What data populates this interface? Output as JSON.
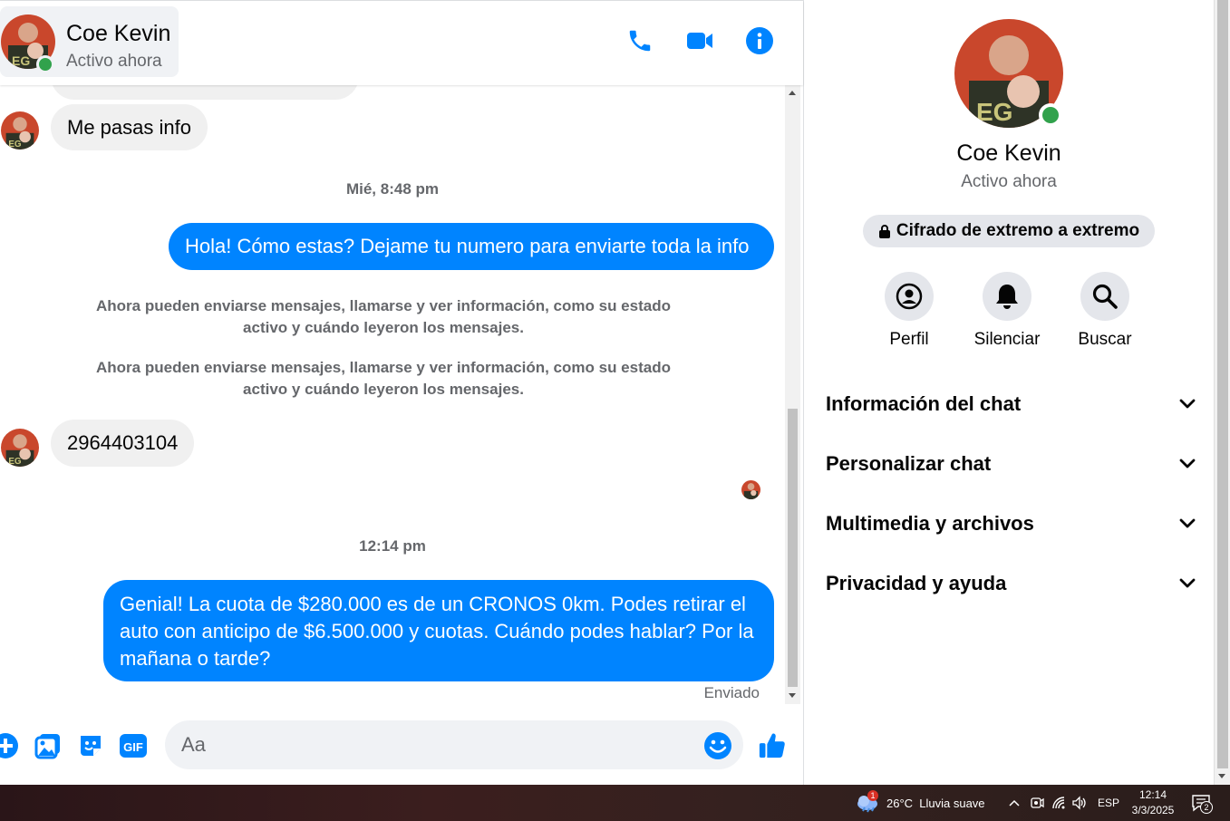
{
  "header": {
    "name": "Coe Kevin",
    "status": "Activo ahora"
  },
  "messages": {
    "incoming_1": "Me pasas info",
    "timestamp_1": "Mié, 8:48 pm",
    "outgoing_1": "Hola! Cómo estas? Dejame tu numero para enviarte toda la info",
    "system_1": "Ahora pueden enviarse mensajes, llamarse y ver información, como su estado activo y cuándo leyeron los mensajes.",
    "system_2": "Ahora pueden enviarse mensajes, llamarse y ver información, como su estado activo y cuándo leyeron los mensajes.",
    "incoming_2": "2964403104",
    "timestamp_2": "12:14 pm",
    "outgoing_2": "Genial! La cuota de $280.000 es de un CRONOS 0km. Podes retirar el auto con anticipo de $6.500.000 y cuotas. Cuándo podes hablar? Por la mañana o tarde?",
    "sent_label": "Enviado"
  },
  "composer": {
    "placeholder": "Aa"
  },
  "panel": {
    "name": "Coe Kevin",
    "status": "Activo ahora",
    "encryption": "Cifrado de extremo a extremo",
    "actions": [
      {
        "label": "Perfil",
        "icon": "profile-icon"
      },
      {
        "label": "Silenciar",
        "icon": "bell-icon"
      },
      {
        "label": "Buscar",
        "icon": "search-icon"
      }
    ],
    "sections": [
      "Información del chat",
      "Personalizar chat",
      "Multimedia y archivos",
      "Privacidad y ayuda"
    ]
  },
  "taskbar": {
    "weather_badge": "1",
    "weather": "26°C  Lluvia suave",
    "language": "ESP",
    "time": "12:14",
    "date": "3/3/2025",
    "notifications": "2"
  },
  "colors": {
    "messenger_blue": "#0084ff",
    "online_green": "#31a24c",
    "bubble_gray": "#f0f0f0"
  }
}
